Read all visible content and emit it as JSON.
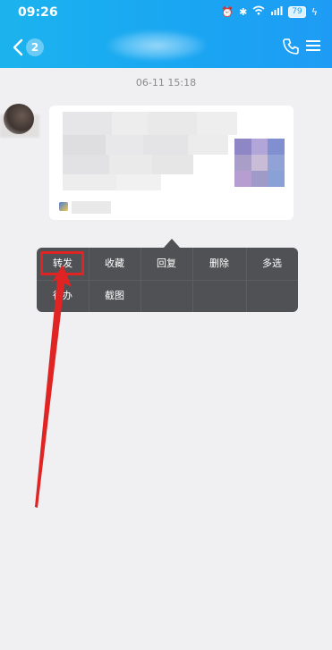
{
  "status_bar": {
    "time": "09:26",
    "battery": "79"
  },
  "header": {
    "back_badge": "2"
  },
  "chat": {
    "timestamp": "06-11 15:18"
  },
  "context_menu": {
    "items": [
      {
        "label": "转发"
      },
      {
        "label": "收藏"
      },
      {
        "label": "回复"
      },
      {
        "label": "删除"
      },
      {
        "label": "多选"
      },
      {
        "label": "待办"
      },
      {
        "label": "截图"
      }
    ]
  },
  "annotation": {
    "highlight_color": "#e02424"
  },
  "colors": {
    "header_blue": "#1aa6f2",
    "menu_bg": "#505154",
    "page_bg": "#f0f0f3"
  }
}
